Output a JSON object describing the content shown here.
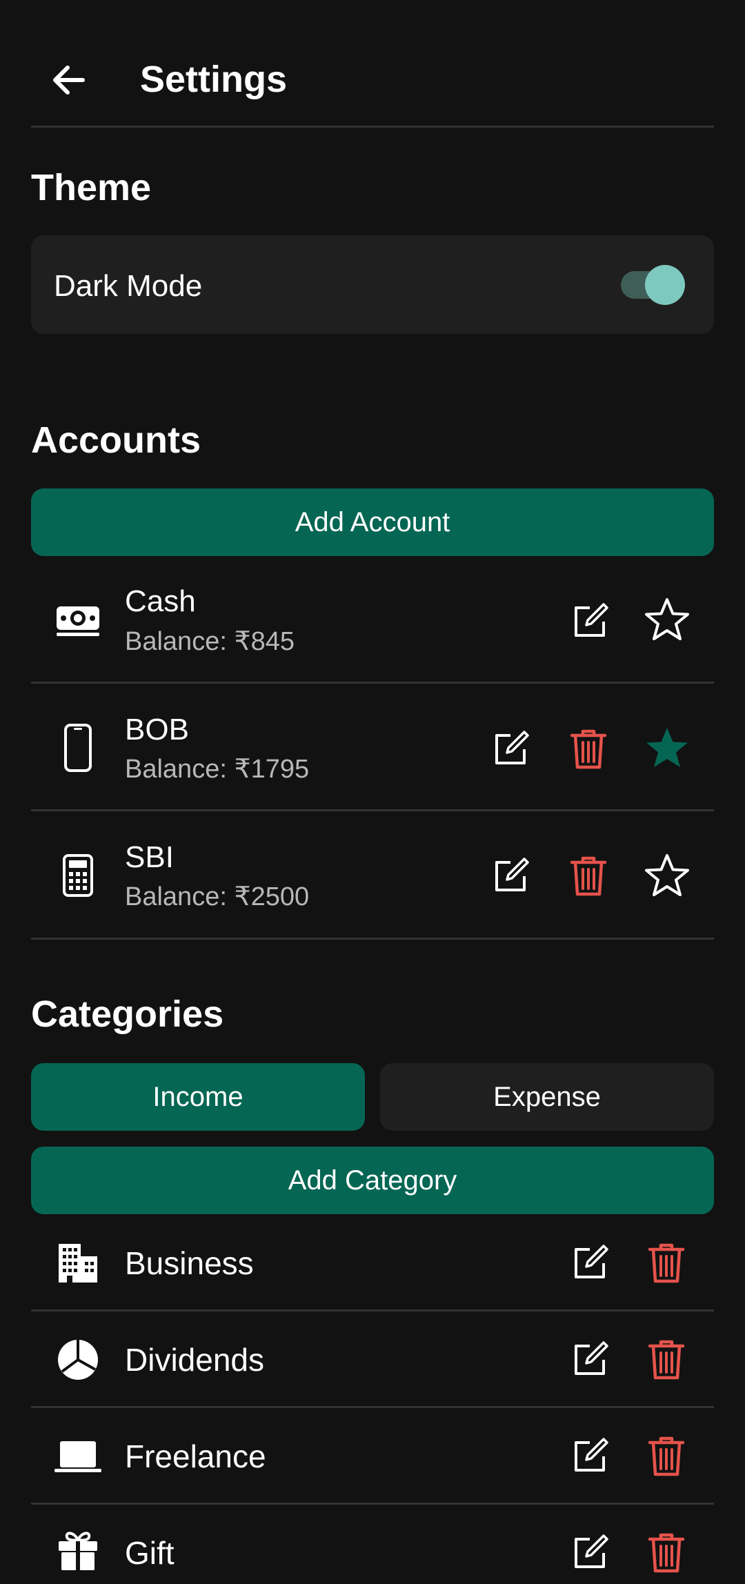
{
  "header": {
    "title": "Settings",
    "back_icon": "arrow-left-icon"
  },
  "theme": {
    "section_title": "Theme",
    "dark_mode_label": "Dark Mode",
    "dark_mode_on": true
  },
  "accounts": {
    "section_title": "Accounts",
    "add_label": "Add Account",
    "items": [
      {
        "name": "Cash",
        "balance": "Balance: ₹845",
        "icon": "money-bill-icon",
        "favorite": false,
        "deletable": false
      },
      {
        "name": "BOB",
        "balance": "Balance: ₹1795",
        "icon": "mobile-phone-icon",
        "favorite": true,
        "deletable": true
      },
      {
        "name": "SBI",
        "balance": "Balance: ₹2500",
        "icon": "calculator-icon",
        "favorite": false,
        "deletable": true
      }
    ]
  },
  "categories": {
    "section_title": "Categories",
    "tabs": [
      {
        "label": "Income",
        "active": true
      },
      {
        "label": "Expense",
        "active": false
      }
    ],
    "add_label": "Add Category",
    "items": [
      {
        "name": "Business",
        "icon": "building-icon"
      },
      {
        "name": "Dividends",
        "icon": "pie-chart-icon"
      },
      {
        "name": "Freelance",
        "icon": "laptop-icon"
      },
      {
        "name": "Gift",
        "icon": "gift-icon"
      }
    ]
  },
  "colors": {
    "background": "#121212",
    "card": "#1f1f1f",
    "accent": "#066654",
    "toggle_knob": "#7ec9bf",
    "delete": "#e5534b",
    "favorite": "#066654"
  }
}
